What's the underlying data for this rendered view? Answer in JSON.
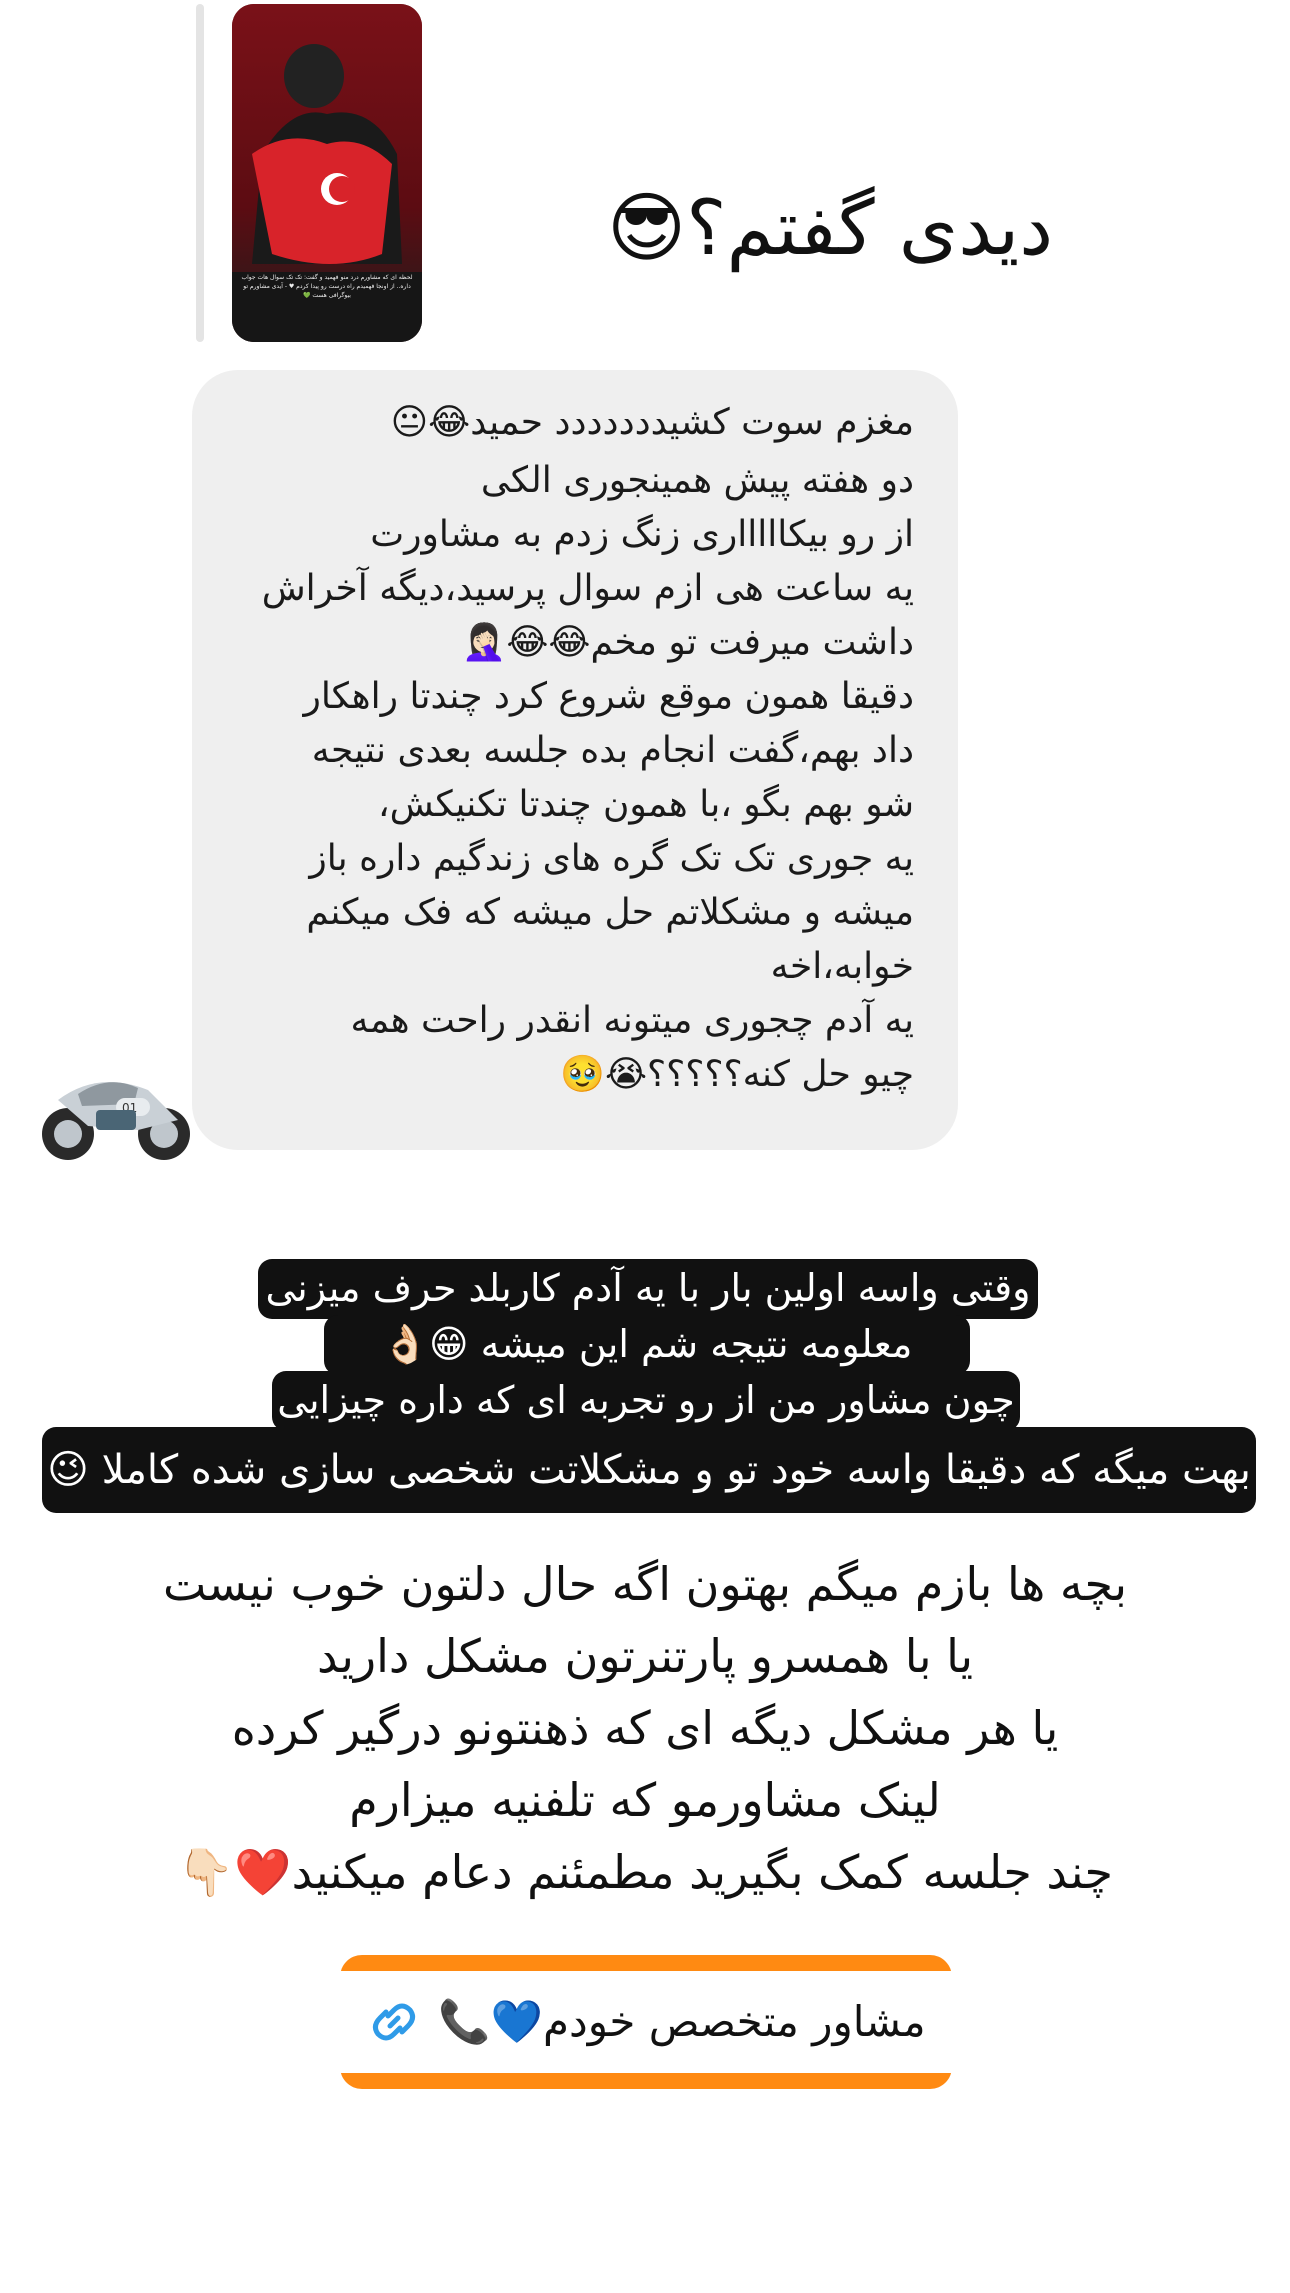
{
  "reply": {
    "text": "دیدی گفتم؟😎",
    "story_caption": "لحظه ای که مشاورم درد منو فهمید و گفت: تک تک سوال هات جواب داره.. از اونجا فهمیدم راه درست رو پیدا کردم ♥ - آیدی مشاورم تو بیوگرافی هست 💚"
  },
  "message": {
    "lines": [
      "مغزم سوت کشیددددددد حمید😂😐",
      "دو هفته پیش همینجوری الکی",
      "از رو بیکاااااری زنگ زدم به مشاورت",
      "یه ساعت هی ازم سوال پرسید،دیگه آخراش",
      "داشت میرفت تو مخم😂😂🤦🏻‍♀️",
      "دقیقا همون موقع شروع کرد چندتا راهکار",
      "داد بهم،گفت انجام بده جلسه بعدی نتیجه",
      "شو بهم بگو ،با همون چندتا تکنیکش،",
      "یه جوری تک تک گره های زندگیم داره باز",
      "میشه و مشکلاتم حل میشه که فک میکنم",
      "خوابه،اخه",
      "یه آدم چجوری میتونه انقدر راحت همه",
      "چیو حل کنه؟؟؟؟؟😭🥹"
    ]
  },
  "caption": {
    "line1": "وقتی واسه اولین بار با یه آدم کاربلد حرف میزنی",
    "line2": "معلومه نتیجه شم این میشه 😁👌🏻",
    "line3": "چون مشاور من از رو تجربه ای که داره چیزایی",
    "line4": "بهت میگه که دقیقا واسه خود تو و مشکلاتت شخصی سازی شده کاملا 😉"
  },
  "body": {
    "line1": "بچه ها بازم میگم بهتون اگه حال دلتون خوب نیست",
    "line2": "یا با همسرو پارتنرتون مشکل دارید",
    "line3": "یا هر مشکل دیگه ای که ذهنتونو درگیر کرده",
    "line4": "لینک مشاورمو که تلفنیه  میزارم",
    "line5": "چند جلسه کمک بگیرید مطمئنم دعام میکنید❤️👇🏻"
  },
  "link": {
    "label": "مشاور متخصص خودم💙📞",
    "icon": "link-icon",
    "accent": "#ff8a12"
  },
  "avatar": {
    "icon": "motorcycle-avatar"
  }
}
